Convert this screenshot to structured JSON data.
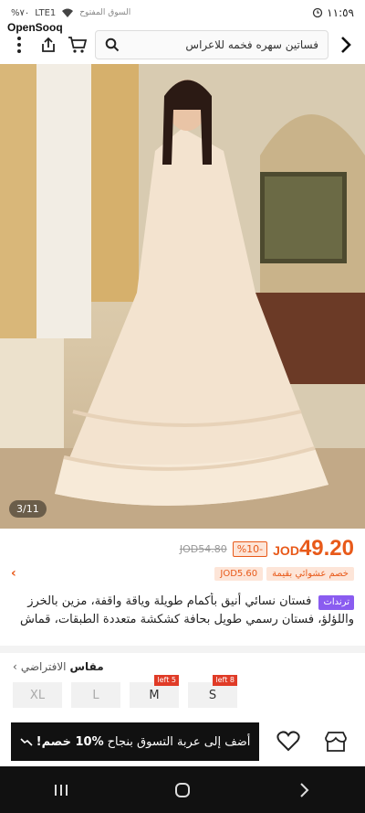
{
  "status_bar": {
    "time": "١١:٥٩",
    "battery": "%٧٠",
    "network": "LTE1",
    "carrier_text": "السوق المفتوح",
    "watermark": "OpenSooq"
  },
  "search": {
    "query": "فساتين سهره فخمه للاعراس"
  },
  "image": {
    "counter": "3/11"
  },
  "price": {
    "currency": "JOD",
    "value": "49.20",
    "discount": "%10-",
    "old_price": "JOD54.80"
  },
  "coupon": {
    "label": "خصم عشوائي بقيمة",
    "amount": "JOD5.60"
  },
  "product": {
    "trend_badge": "ترندات",
    "title_line_1": "فستان نسائي أنيق بأكمام طويلة وياقة واقفة، مزين بالخرز",
    "title_line_2": "واللؤلؤ، فستان رسمي طويل بحافة كشكشة متعددة الطبقات، قماش"
  },
  "size": {
    "label": "مقاس",
    "value": "الافتراضي",
    "options": [
      {
        "label": "S",
        "badge": "8 left",
        "muted": false
      },
      {
        "label": "M",
        "badge": "5 left",
        "muted": false
      },
      {
        "label": "L",
        "badge": "",
        "muted": true
      },
      {
        "label": "XL",
        "badge": "",
        "muted": true
      }
    ]
  },
  "cta": {
    "discount_text": "10% خصم!",
    "action_text": "أضف إلى عربة التسوق بنجاح"
  },
  "colors": {
    "accent": "#e85a1a",
    "trend": "#8a5cf0",
    "stock_badge": "#e03b27",
    "cta_bg": "#111111"
  },
  "icons": {
    "back": "chevron-right-icon",
    "search": "search-icon",
    "cart": "cart-icon",
    "share": "share-icon",
    "more": "more-vertical-icon",
    "wishlist": "heart-icon",
    "store": "store-icon"
  }
}
